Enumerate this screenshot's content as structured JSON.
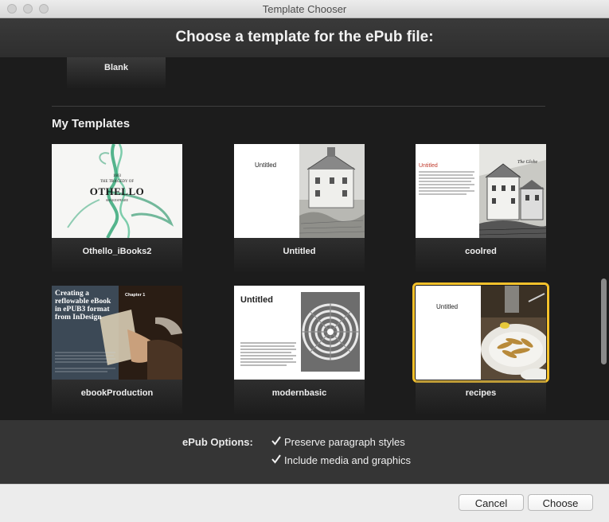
{
  "window": {
    "title": "Template Chooser"
  },
  "header": {
    "title": "Choose a template for the ePub file:"
  },
  "blank": {
    "label": "Blank"
  },
  "my_templates": {
    "title": "My Templates",
    "items": [
      {
        "label": "Othello_iBooks2",
        "cover_line1": "1603",
        "cover_line2": "THE TRAGEDY OF",
        "cover_title": "OTHELLO",
        "cover_sub": "SHAKESPEARE"
      },
      {
        "label": "Untitled",
        "page_title": "Untitled"
      },
      {
        "label": "coolred",
        "page_title": "Untitled",
        "corner": "The Globe"
      },
      {
        "label": "ebookProduction",
        "heading": "Creating a reflowable eBook in ePUB3 format from InDesign",
        "chapter": "Chapter 1"
      },
      {
        "label": "modernbasic",
        "page_title": "Untitled"
      },
      {
        "label": "recipes",
        "page_title": "Untitled"
      }
    ]
  },
  "options": {
    "label": "ePub Options:",
    "preserve_styles": "Preserve paragraph styles",
    "include_media": "Include media and graphics",
    "preserve_checked": true,
    "include_checked": true
  },
  "buttons": {
    "cancel": "Cancel",
    "choose": "Choose"
  },
  "colors": {
    "selection": "#f5c12b",
    "background": "#1c1c1c"
  }
}
